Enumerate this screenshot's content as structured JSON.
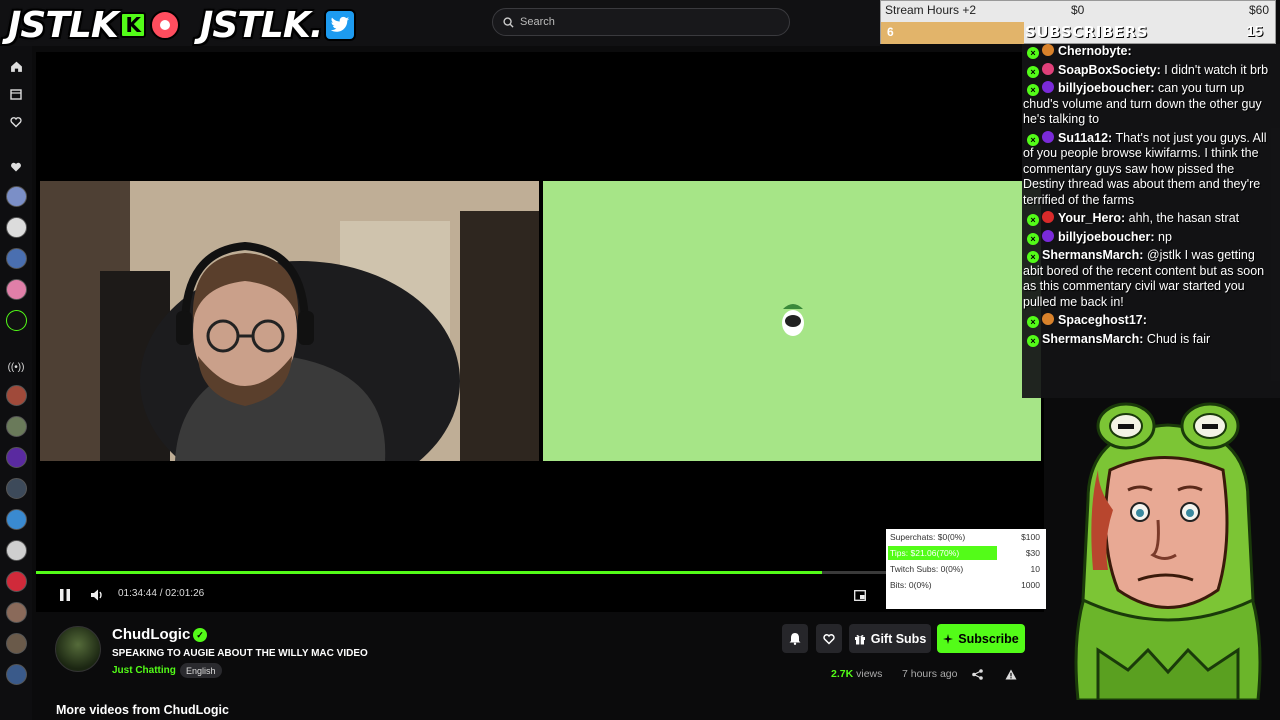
{
  "header": {
    "logo1_text": "JSTLK",
    "kick_letter": "K",
    "logo2_text": "JSTLK.",
    "search_placeholder": "Search"
  },
  "stream_hours": {
    "title": "Stream Hours +2",
    "min": "$0",
    "max": "$60",
    "current": "6",
    "progress": 0.36
  },
  "subscribers": {
    "label": "SUBSCRIBERS",
    "count": "15"
  },
  "chat": {
    "messages": [
      {
        "user": "Chernobyte:",
        "text": "",
        "dot": "#d9822b"
      },
      {
        "user": "SoapBoxSociety:",
        "text": "I didn't watch it brb",
        "dot": "#e0407a"
      },
      {
        "user": "billyjoeboucher:",
        "text": "can you turn up chud's volume and turn down the other guy he's talking to",
        "dot": "#7a2ad9"
      },
      {
        "user": "Su11a12:",
        "text": "That's not just you guys. All of you people browse kiwifarms. I think the commentary guys saw how pissed the Destiny thread was about them and they're terrified of the farms",
        "dot": "#7a2ad9"
      },
      {
        "user": "Your_Hero:",
        "text": "ahh, the hasan strat",
        "dot": "#d92a2a"
      },
      {
        "user": "billyjoeboucher:",
        "text": "np",
        "dot": "#7a2ad9"
      },
      {
        "user": "ShermansMarch:",
        "text": "@jstlk I was getting abit bored of the recent content but as soon as this commentary civil war started you pulled me back in!",
        "dot": ""
      },
      {
        "user": "Spaceghost17:",
        "text": "",
        "dot": "#d9822b"
      },
      {
        "user": "ShermansMarch:",
        "text": "Chud is fair",
        "dot": ""
      }
    ]
  },
  "player": {
    "time": "01:34:44 / 02:01:26",
    "progress": 0.78
  },
  "tips_overlay": {
    "rows": [
      {
        "label": "Superchats:",
        "value": "$0(0%)",
        "max": "$100",
        "fill": 0
      },
      {
        "label": "Tips:",
        "value": "$21.06(70%)",
        "max": "$30",
        "fill": 0.7
      },
      {
        "label": "Twitch Subs:",
        "value": "0(0%)",
        "max": "10",
        "fill": 0
      },
      {
        "label": "Bits:",
        "value": "0(0%)",
        "max": "1000",
        "fill": 0
      }
    ]
  },
  "channel": {
    "name": "ChudLogic",
    "title": "SPEAKING TO AUGIE ABOUT THE WILLY MAC VIDEO",
    "category": "Just Chatting",
    "language": "English",
    "views_count": "2.7K",
    "views_label": "views",
    "ago": "7 hours ago",
    "gift_label": "Gift Subs",
    "subscribe_label": "Subscribe",
    "more_videos": "More videos from ChudLogic"
  },
  "colors": {
    "accent": "#53fc18",
    "background": "#0b0b0c"
  }
}
